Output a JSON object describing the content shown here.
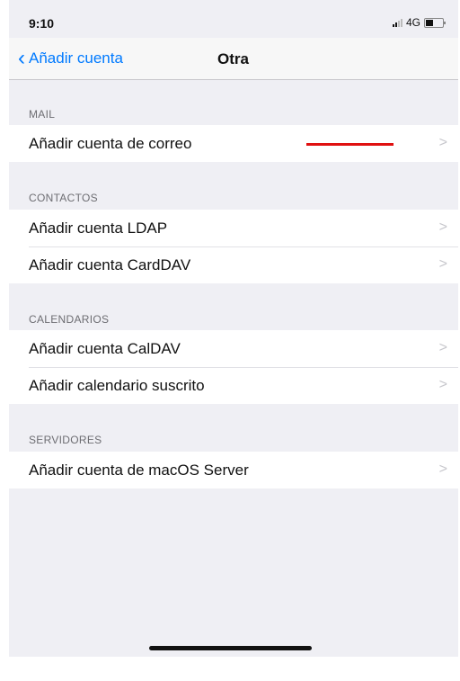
{
  "status_bar": {
    "time": "9:10",
    "network": "4G"
  },
  "nav": {
    "back_label": "Añadir cuenta",
    "title": "Otra"
  },
  "sections": [
    {
      "header": "MAIL",
      "items": [
        {
          "label": "Añadir cuenta de correo"
        }
      ]
    },
    {
      "header": "CONTACTOS",
      "items": [
        {
          "label": "Añadir cuenta LDAP"
        },
        {
          "label": "Añadir cuenta CardDAV"
        }
      ]
    },
    {
      "header": "CALENDARIOS",
      "items": [
        {
          "label": "Añadir cuenta CalDAV"
        },
        {
          "label": "Añadir calendario suscrito"
        }
      ]
    },
    {
      "header": "SERVIDORES",
      "items": [
        {
          "label": "Añadir cuenta de macOS Server"
        }
      ]
    }
  ],
  "colors": {
    "accent": "#007aff",
    "annotation": "#e01010",
    "background": "#efeff4"
  }
}
